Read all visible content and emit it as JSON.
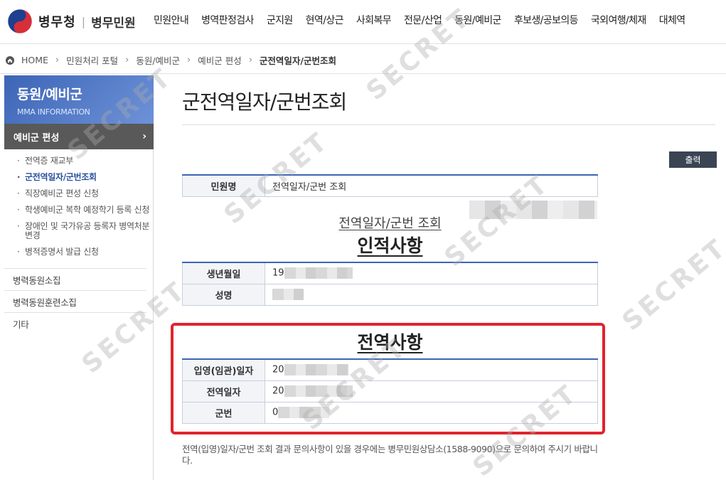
{
  "header": {
    "logo_main": "병무청",
    "logo_sep": "|",
    "logo_sub": "병무민원",
    "nav": [
      "민원안내",
      "병역판정검사",
      "군지원",
      "현역/상근",
      "사회복무",
      "전문/산업",
      "동원/예비군",
      "후보생/공보의등",
      "국외여행/체재",
      "대체역"
    ]
  },
  "breadcrumb": {
    "items": [
      "HOME",
      "민원처리 포털",
      "동원/예비군",
      "예비군 편성",
      "군전역일자/군번조회"
    ],
    "sep": "›"
  },
  "sidebar": {
    "title": "동원/예비군",
    "subtitle": "MMA INFORMATION",
    "active_group": "예비군 편성",
    "chevron": "›",
    "sub_items": [
      "전역증 재교부",
      "군전역일자/군번조회",
      "직장예비군 편성 신청",
      "학생예비군 복학 예정학기 등록 신청",
      "장애인 및 국가유공 등록자 병역처분변경",
      "병적증명서 발급 신청"
    ],
    "groups": [
      "병력동원소집",
      "병력동원훈련소집",
      "기타"
    ]
  },
  "main": {
    "title": "군전역일자/군번조회",
    "print_label": "출력",
    "doc_row": {
      "label": "민원명",
      "value": "전역일자/군번 조회"
    },
    "doc_caption": "전역일자/군번 조회",
    "personal_heading": "인적사항",
    "personal_rows": [
      {
        "label": "생년월일",
        "value": "19"
      },
      {
        "label": "성명",
        "value": ""
      }
    ],
    "service_heading": "전역사항",
    "service_rows": [
      {
        "label": "입영(임관)일자",
        "value": "20"
      },
      {
        "label": "전역일자",
        "value": "20"
      },
      {
        "label": "군번",
        "value": "0"
      }
    ],
    "notice": "전역(입영)일자/군번 조회 결과 문의사항이 있을 경우에는 병무민원상담소(1588-9090)으로 문의하여 주시기 바랍니다."
  },
  "watermark": "SECRET",
  "colors": {
    "accent": "#3c65b6",
    "highlight": "#e0232f",
    "sidebar_active": "#595959",
    "print_button": "#3a4453"
  }
}
